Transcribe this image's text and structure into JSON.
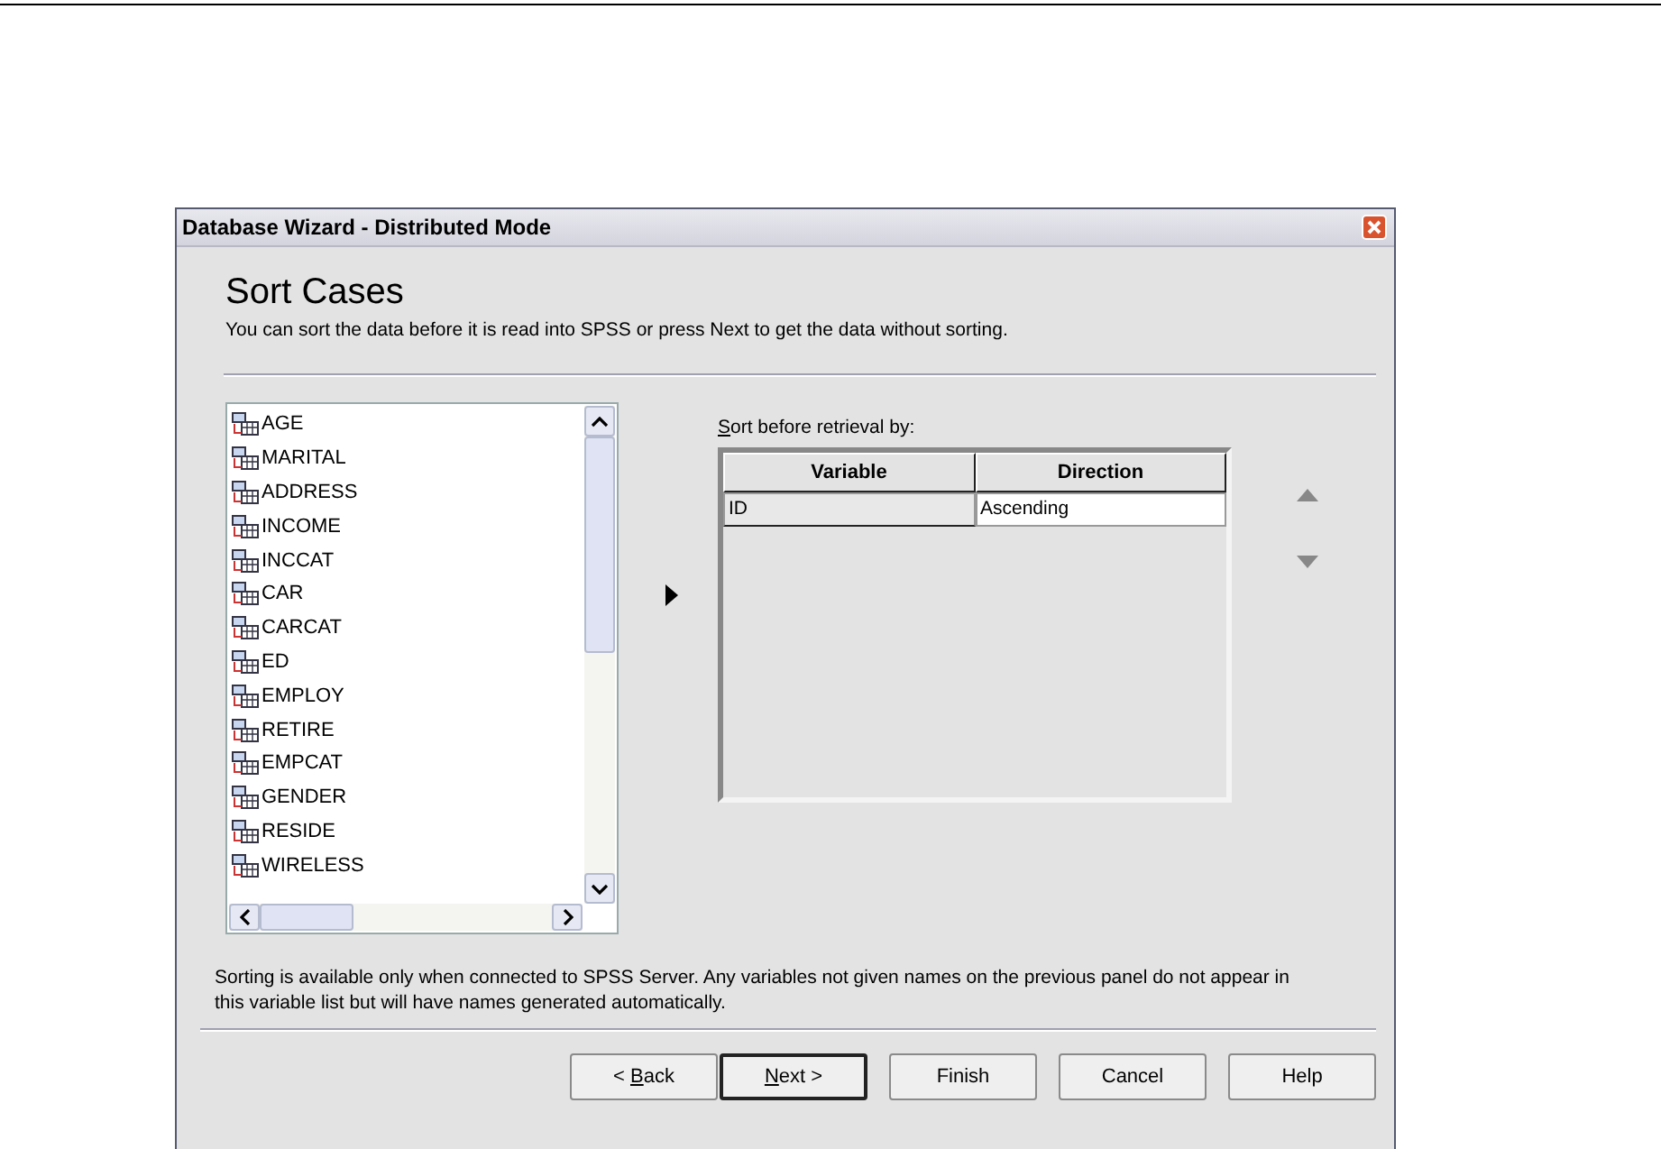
{
  "window": {
    "title": "Database Wizard - Distributed Mode"
  },
  "heading": "Sort Cases",
  "intro": "You can sort the data before it is read into SPSS or press Next to get the data without sorting.",
  "variables": [
    "AGE",
    "MARITAL",
    "ADDRESS",
    "INCOME",
    "INCCAT",
    "CAR",
    "CARCAT",
    "ED",
    "EMPLOY",
    "RETIRE",
    "EMPCAT",
    "GENDER",
    "RESIDE",
    "WIRELESS"
  ],
  "sort_label": {
    "key": "S",
    "rest": "ort before retrieval by:"
  },
  "table": {
    "columns": [
      "Variable",
      "Direction"
    ],
    "rows": [
      [
        "ID",
        "Ascending"
      ]
    ]
  },
  "note": "Sorting is available only when connected to SPSS Server. Any variables not given names on the previous panel do not appear in this variable list but will have names generated automatically.",
  "buttons": [
    {
      "label": "< ",
      "key": "B",
      "rest": "ack",
      "default": false
    },
    {
      "key": "N",
      "rest": "ext >",
      "default": true
    },
    {
      "label": "Finish",
      "default": false
    },
    {
      "label": "Cancel",
      "default": false
    },
    {
      "label": "Help",
      "default": false
    }
  ]
}
